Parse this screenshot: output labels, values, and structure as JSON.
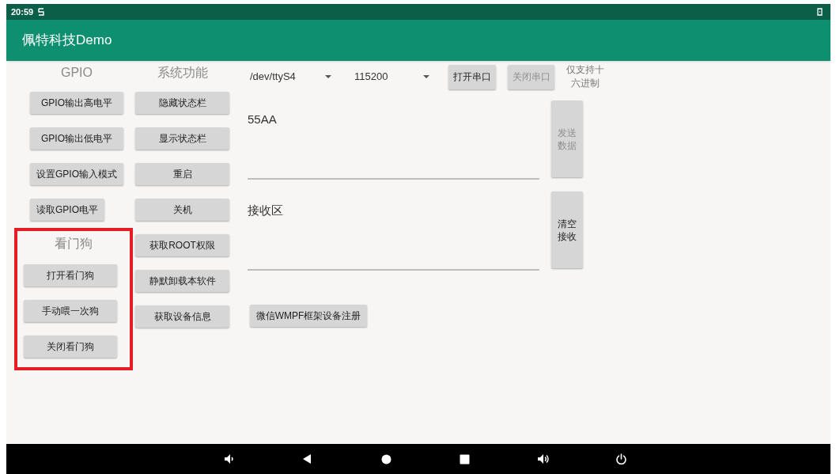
{
  "status_bar": {
    "time": "20:59"
  },
  "app_bar": {
    "title": "佩特科技Demo"
  },
  "gpio": {
    "title": "GPIO",
    "buttons": [
      {
        "label": "GPIO输出高电平",
        "disabled": false
      },
      {
        "label": "GPIO输出低电平",
        "disabled": false
      },
      {
        "label": "设置GPIO输入模式",
        "disabled": false
      },
      {
        "label": "读取GPIO电平",
        "disabled": false
      }
    ]
  },
  "watchdog": {
    "title": "看门狗",
    "highlighted": true,
    "buttons": [
      {
        "label": "打开看门狗",
        "disabled": false
      },
      {
        "label": "手动喂一次狗",
        "disabled": false
      },
      {
        "label": "关闭看门狗",
        "disabled": false
      }
    ]
  },
  "system": {
    "title": "系统功能",
    "buttons": [
      {
        "label": "隐藏状态栏",
        "disabled": false
      },
      {
        "label": "显示状态栏",
        "disabled": false
      },
      {
        "label": "重启",
        "disabled": false
      },
      {
        "label": "关机",
        "disabled": false
      },
      {
        "label": "获取ROOT权限",
        "disabled": false
      },
      {
        "label": "静默卸载本软件",
        "disabled": false
      },
      {
        "label": "获取设备信息",
        "disabled": false
      }
    ]
  },
  "serial": {
    "port": {
      "value": "/dev/ttyS4"
    },
    "baud": {
      "value": "115200"
    },
    "open_button": {
      "label": "打开串口",
      "disabled": false
    },
    "close_button": {
      "label": "关闭串口",
      "disabled": true
    },
    "hex_note": "仅支持十六进制",
    "send_field": {
      "value": "55AA"
    },
    "send_button": {
      "label": "发送数据",
      "disabled": true
    },
    "receive_field": {
      "value": "接收区"
    },
    "clear_button": {
      "label": "清空接收",
      "disabled": false
    },
    "wmpf_button": {
      "label": "微信WMPF框架设备注册",
      "disabled": false
    }
  }
}
